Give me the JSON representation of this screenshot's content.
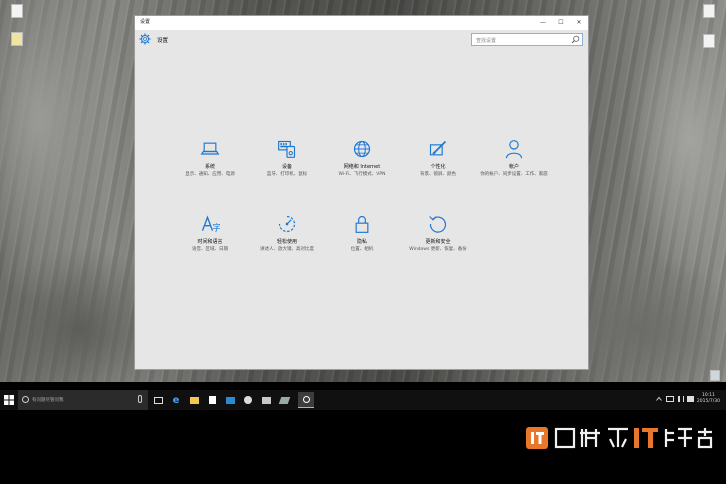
{
  "window": {
    "title": "设置",
    "header_title": "设置",
    "search_placeholder": "查找设置",
    "controls": {
      "minimize": "—",
      "maximize": "☐",
      "close": "✕"
    }
  },
  "categories": [
    {
      "name": "系统",
      "desc": "显示、通知、应用、电源",
      "icon": "laptop-icon"
    },
    {
      "name": "设备",
      "desc": "蓝牙、打印机、鼠标",
      "icon": "devices-icon"
    },
    {
      "name": "网络和 Internet",
      "desc": "Wi-Fi、飞行模式、VPN",
      "icon": "globe-icon"
    },
    {
      "name": "个性化",
      "desc": "背景、锁屏、颜色",
      "icon": "personalization-icon"
    },
    {
      "name": "帐户",
      "desc": "你的帐户、同步设置、工作、家庭",
      "icon": "person-icon"
    },
    {
      "name": "时间和语言",
      "desc": "语音、区域、日期",
      "icon": "time-language-icon"
    },
    {
      "name": "轻松使用",
      "desc": "讲述人、放大镜、高对比度",
      "icon": "ease-of-access-icon"
    },
    {
      "name": "隐私",
      "desc": "位置、相机",
      "icon": "lock-icon"
    },
    {
      "name": "更新和安全",
      "desc": "Windows 更新、恢复、备份",
      "icon": "update-icon"
    }
  ],
  "taskbar": {
    "search_placeholder": "有问题尽管问我",
    "time": "10:11",
    "date": "2015/7/30"
  },
  "colors": {
    "accent": "#1e78d2",
    "taskbar": "#101010",
    "window_bg": "#e6e6e6"
  }
}
